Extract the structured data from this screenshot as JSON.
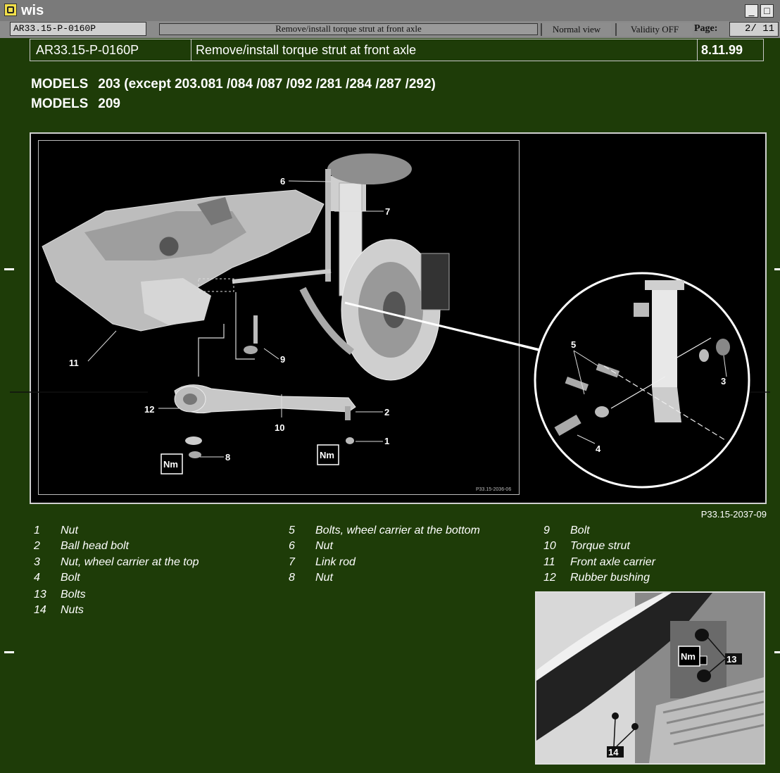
{
  "window": {
    "title": "wis",
    "minimize": "_",
    "maximize": "□"
  },
  "toolbar": {
    "doc_id": "AR33.15-P-0160P",
    "title": "Remove/install torque strut at front axle",
    "normal_view": "Normal view",
    "validity": "Validity OFF",
    "page_label": "Page:",
    "page_value": "2/ 11"
  },
  "header": {
    "doc_id": "AR33.15-P-0160P",
    "title": "Remove/install torque strut at front axle",
    "date": "8.11.99"
  },
  "models": [
    {
      "label": "MODELS",
      "value": "203 (except 203.081 /084 /087 /092 /281 /284 /287 /292)"
    },
    {
      "label": "MODELS",
      "value": "209"
    }
  ],
  "figure": {
    "ref": "P33.15-2037-09",
    "inner_ref": "P33.15-2036-06",
    "callouts": [
      "1",
      "2",
      "3",
      "4",
      "5",
      "6",
      "7",
      "8",
      "9",
      "10",
      "11",
      "12"
    ],
    "torque_label": "Nm"
  },
  "legend": [
    {
      "num": "1",
      "text": "Nut"
    },
    {
      "num": "2",
      "text": "Ball head bolt"
    },
    {
      "num": "3",
      "text": "Nut, wheel carrier at the top"
    },
    {
      "num": "4",
      "text": "Bolt"
    },
    {
      "num": "13",
      "text": "Bolts"
    },
    {
      "num": "14",
      "text": "Nuts"
    },
    {
      "num": "5",
      "text": "Bolts, wheel carrier at the bottom"
    },
    {
      "num": "6",
      "text": "Nut"
    },
    {
      "num": "7",
      "text": "Link rod"
    },
    {
      "num": "8",
      "text": "Nut"
    },
    {
      "num": "9",
      "text": "Bolt"
    },
    {
      "num": "10",
      "text": "Torque strut"
    },
    {
      "num": "11",
      "text": "Front axle carrier"
    },
    {
      "num": "12",
      "text": "Rubber bushing"
    }
  ],
  "photo": {
    "callout_13": "13",
    "callout_14": "14",
    "torque_label": "Nm"
  },
  "colors": {
    "background": "#1e3c08",
    "titlebar": "#7a7a7a",
    "panel": "#000000"
  }
}
